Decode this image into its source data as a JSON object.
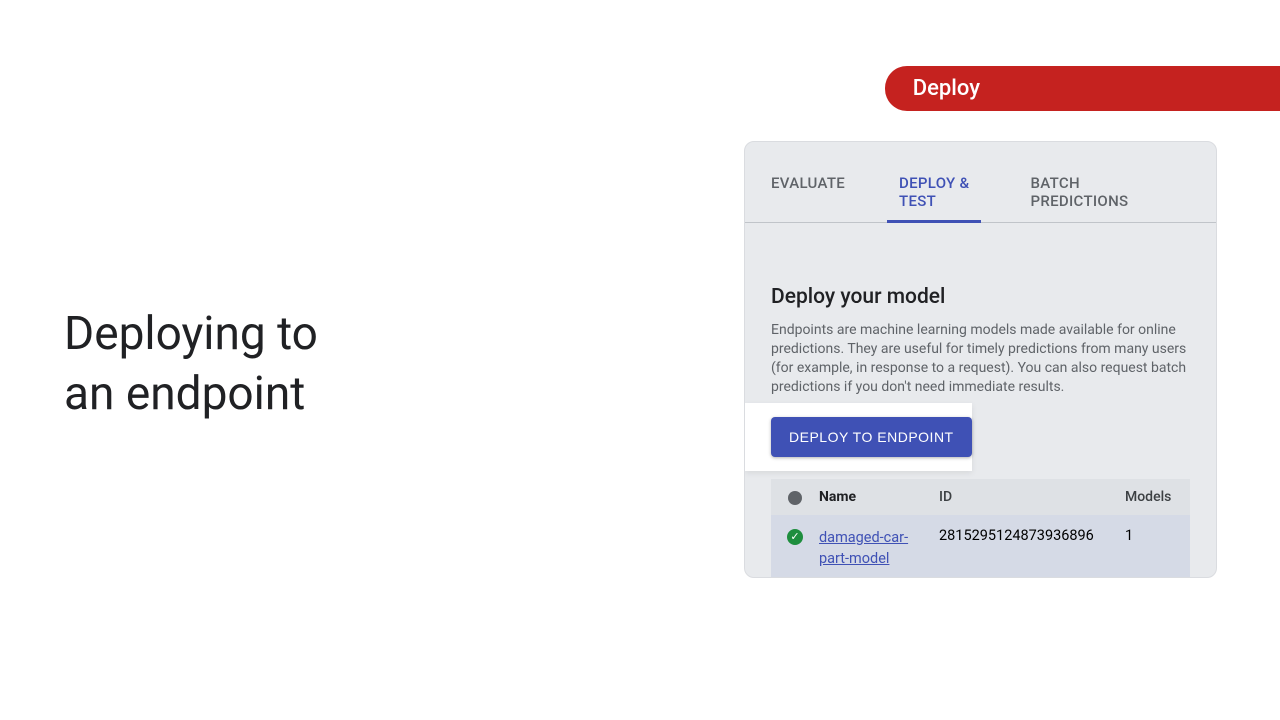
{
  "slide": {
    "title_line1": "Deploying to",
    "title_line2": "an endpoint"
  },
  "pill": {
    "label": "Deploy"
  },
  "panel": {
    "tabs": [
      {
        "label": "EVALUATE",
        "active": false
      },
      {
        "label": "DEPLOY & TEST",
        "active": true
      },
      {
        "label": "BATCH PREDICTIONS",
        "active": false
      }
    ],
    "section_title": "Deploy your model",
    "description": "Endpoints are machine learning models made available for online predictions. They are useful for timely predictions from many users (for example, in response to a request). You can also request batch predictions if you don't need immediate results.",
    "deploy_button": "DEPLOY TO ENDPOINT",
    "table": {
      "headers": {
        "name": "Name",
        "id": "ID",
        "models": "Models"
      },
      "rows": [
        {
          "status_icon": "success-check-icon",
          "name": "damaged-car-part-model",
          "id": "2815295124873936896",
          "models": "1"
        }
      ]
    }
  }
}
